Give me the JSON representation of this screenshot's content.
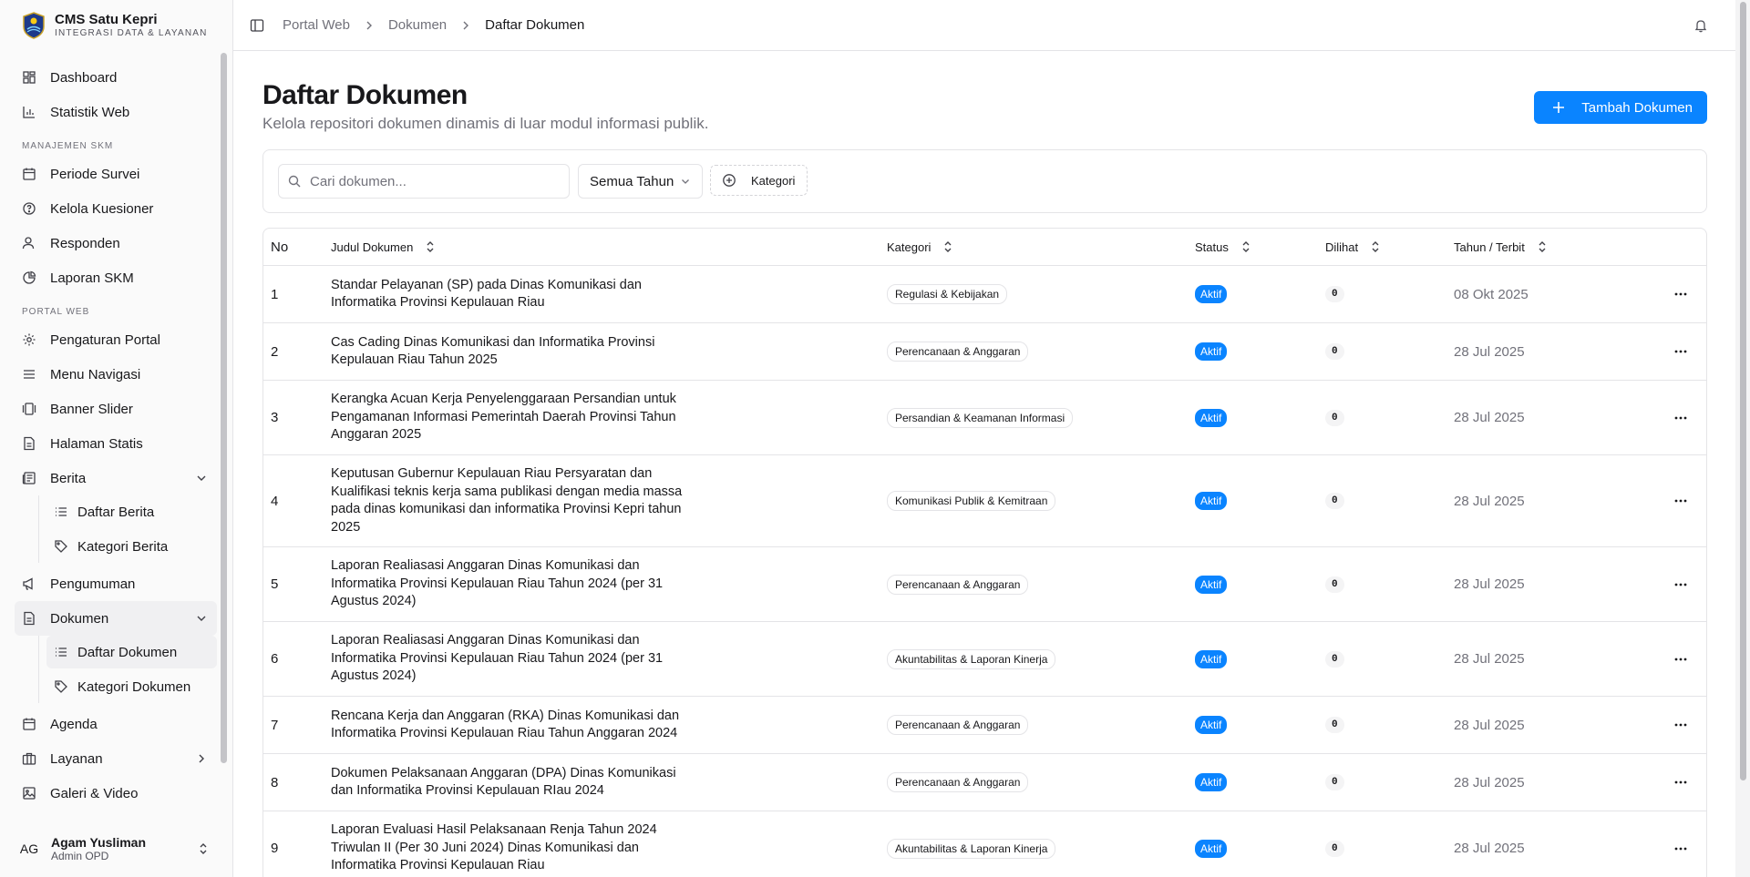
{
  "brand": {
    "title": "CMS Satu Kepri",
    "subtitle": "INTEGRASI DATA & LAYANAN"
  },
  "sidebar": {
    "top": [
      {
        "label": "Dashboard",
        "icon": "dashboard-icon"
      },
      {
        "label": "Statistik Web",
        "icon": "bar-chart-icon"
      }
    ],
    "section_skm": "MANAJEMEN SKM",
    "skm": [
      {
        "label": "Periode Survei",
        "icon": "calendar-icon"
      },
      {
        "label": "Kelola Kuesioner",
        "icon": "help-circle-icon"
      },
      {
        "label": "Responden",
        "icon": "user-icon"
      },
      {
        "label": "Laporan SKM",
        "icon": "chart-pie-icon"
      }
    ],
    "section_portal": "PORTAL WEB",
    "portal": [
      {
        "label": "Pengaturan Portal"
      },
      {
        "label": "Menu Navigasi"
      },
      {
        "label": "Banner Slider"
      },
      {
        "label": "Halaman Statis"
      }
    ],
    "berita": {
      "label": "Berita",
      "children": [
        "Daftar Berita",
        "Kategori Berita"
      ]
    },
    "pengumuman": "Pengumuman",
    "dokumen": {
      "label": "Dokumen",
      "children": [
        "Daftar Dokumen",
        "Kategori Dokumen"
      ]
    },
    "bottom": [
      {
        "label": "Agenda"
      },
      {
        "label": "Layanan"
      },
      {
        "label": "Galeri & Video"
      }
    ]
  },
  "user": {
    "initials": "AG",
    "name": "Agam Yusliman",
    "role": "Admin OPD"
  },
  "breadcrumb": [
    "Portal Web",
    "Dokumen",
    "Daftar Dokumen"
  ],
  "page": {
    "title": "Daftar Dokumen",
    "description": "Kelola repositori dokumen dinamis di luar modul informasi publik.",
    "add_button": "Tambah Dokumen"
  },
  "filters": {
    "search_placeholder": "Cari dokumen...",
    "year_select": "Semua Tahun",
    "category_button": "Kategori"
  },
  "table": {
    "headers": {
      "no": "No",
      "title": "Judul Dokumen",
      "category": "Kategori",
      "status": "Status",
      "views": "Dilihat",
      "year": "Tahun / Terbit"
    },
    "rows": [
      {
        "no": "1",
        "title": "Standar Pelayanan (SP) pada Dinas Komunikasi dan Informatika Provinsi Kepulauan Riau",
        "category": "Regulasi & Kebijakan",
        "status": "Aktif",
        "views": "0",
        "date": "08 Okt 2025"
      },
      {
        "no": "2",
        "title": "Cas Cading Dinas Komunikasi dan Informatika Provinsi Kepulauan Riau Tahun 2025",
        "category": "Perencanaan & Anggaran",
        "status": "Aktif",
        "views": "0",
        "date": "28 Jul 2025"
      },
      {
        "no": "3",
        "title": "Kerangka Acuan Kerja Penyelenggaraan Persandian untuk Pengamanan Informasi Pemerintah Daerah Provinsi Tahun Anggaran 2025",
        "category": "Persandian & Keamanan Informasi",
        "status": "Aktif",
        "views": "0",
        "date": "28 Jul 2025"
      },
      {
        "no": "4",
        "title": "Keputusan Gubernur Kepulauan Riau Persyaratan dan Kualifikasi teknis kerja sama publikasi dengan media massa pada dinas komunikasi dan informatika Provinsi Kepri tahun 2025",
        "category": "Komunikasi Publik & Kemitraan",
        "status": "Aktif",
        "views": "0",
        "date": "28 Jul 2025"
      },
      {
        "no": "5",
        "title": "Laporan Realiasasi Anggaran Dinas Komunikasi dan Informatika Provinsi Kepulauan Riau Tahun 2024 (per 31 Agustus 2024)",
        "category": "Perencanaan & Anggaran",
        "status": "Aktif",
        "views": "0",
        "date": "28 Jul 2025"
      },
      {
        "no": "6",
        "title": "Laporan Realiasasi Anggaran Dinas Komunikasi dan Informatika Provinsi Kepulauan Riau Tahun 2024 (per 31 Agustus 2024)",
        "category": "Akuntabilitas & Laporan Kinerja",
        "status": "Aktif",
        "views": "0",
        "date": "28 Jul 2025"
      },
      {
        "no": "7",
        "title": "Rencana Kerja dan Anggaran (RKA) Dinas Komunikasi dan Informatika Provinsi Kepulauan Riau Tahun Anggaran 2024",
        "category": "Perencanaan & Anggaran",
        "status": "Aktif",
        "views": "0",
        "date": "28 Jul 2025"
      },
      {
        "no": "8",
        "title": "Dokumen Pelaksanaan Anggaran (DPA) Dinas Komunikasi dan Informatika Provinsi Kepulauan RIau 2024",
        "category": "Perencanaan & Anggaran",
        "status": "Aktif",
        "views": "0",
        "date": "28 Jul 2025"
      },
      {
        "no": "9",
        "title": "Laporan Evaluasi Hasil Pelaksanaan Renja Tahun 2024 Triwulan II (Per 30 Juni 2024) Dinas Komunikasi dan Informatika Provinsi Kepulauan Riau",
        "category": "Akuntabilitas & Laporan Kinerja",
        "status": "Aktif",
        "views": "0",
        "date": "28 Jul 2025"
      }
    ]
  },
  "colors": {
    "accent": "#0a84ff",
    "border": "#e4e4e7",
    "muted": "#71717a"
  }
}
